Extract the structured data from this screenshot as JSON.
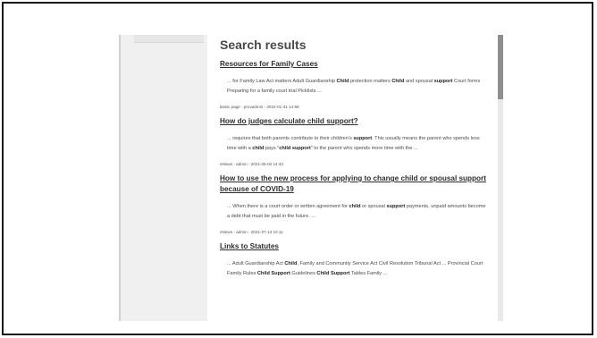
{
  "page": {
    "heading": "Search results"
  },
  "results": [
    {
      "title": "Resources for Family Cases",
      "snippet": [
        {
          "t": "... for Family Law Act matters Adult Guardianship ",
          "b": false
        },
        {
          "t": "Child",
          "b": true
        },
        {
          "t": " protection matters ",
          "b": false
        },
        {
          "t": "Child",
          "b": true
        },
        {
          "t": " and spousal ",
          "b": false
        },
        {
          "t": "support",
          "b": true
        },
        {
          "t": " Court forms Preparing for a family court trial Picklists ...",
          "b": false
        }
      ],
      "meta": "Basic page - provadmin - 2022-01-31 14:58"
    },
    {
      "title": "How do judges calculate child support?",
      "snippet": [
        {
          "t": "... requires that both parents contribute to their children's ",
          "b": false
        },
        {
          "t": "support",
          "b": true
        },
        {
          "t": ". This usually means the parent who spends less time with a ",
          "b": false
        },
        {
          "t": "child",
          "b": true
        },
        {
          "t": " pays \"",
          "b": false
        },
        {
          "t": "child support",
          "b": true
        },
        {
          "t": "\" to the parent who spends more time with the ...",
          "b": false
        }
      ],
      "meta": "eNews - admin - 2021-06-02 14:43"
    },
    {
      "title": "How to use the new process for applying to change child or spousal support because of COVID-19",
      "snippet": [
        {
          "t": "... When there is a court order or written agreement for ",
          "b": false
        },
        {
          "t": "child",
          "b": true
        },
        {
          "t": " or spousal ",
          "b": false
        },
        {
          "t": "support",
          "b": true
        },
        {
          "t": " payments, unpaid amounts become a debt that must be paid in the future. ...",
          "b": false
        }
      ],
      "meta": "eNews - admin - 2021-07-13 10:11"
    },
    {
      "title": "Links to Statutes",
      "snippet": [
        {
          "t": "... Adult Guardianship Act ",
          "b": false
        },
        {
          "t": "Child",
          "b": true
        },
        {
          "t": ", Family and Community Service Act Civil Resolution Tribunal Act ... Provincial Court Family Rules ",
          "b": false
        },
        {
          "t": "Child Support",
          "b": true
        },
        {
          "t": " Guidelines ",
          "b": false
        },
        {
          "t": "Child Support",
          "b": true
        },
        {
          "t": " Tables Family ...",
          "b": false
        }
      ],
      "meta": ""
    }
  ]
}
